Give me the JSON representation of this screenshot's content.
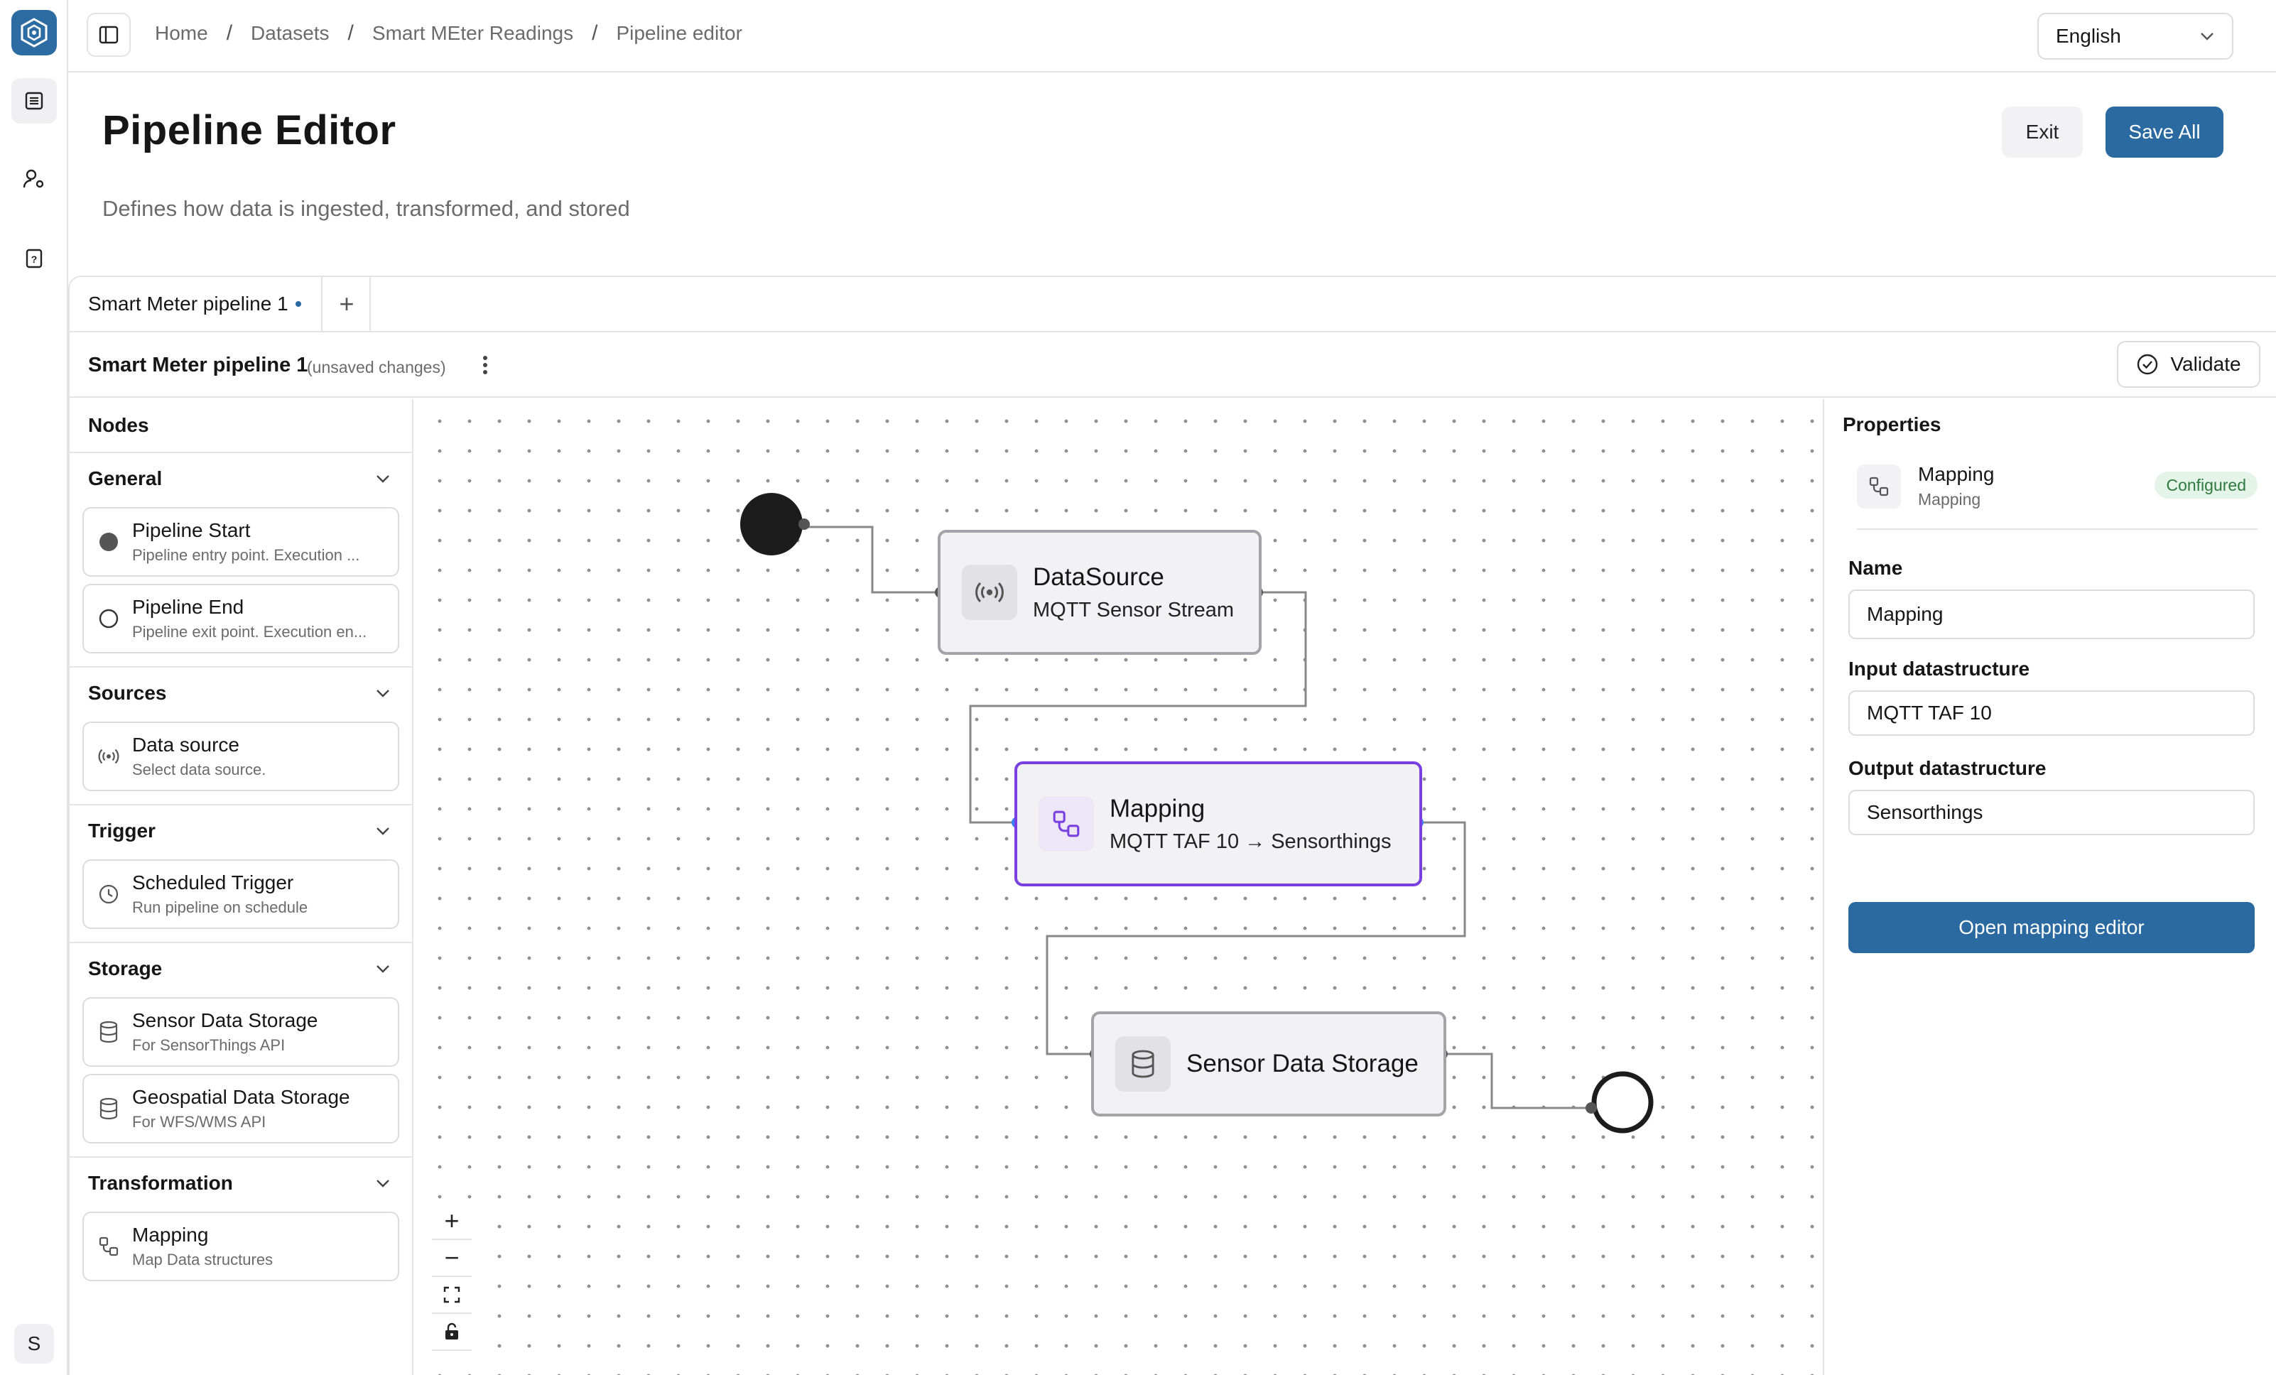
{
  "rail": {
    "items": [
      "datasets-icon",
      "user-settings-icon",
      "help-icon"
    ],
    "user_initial": "S"
  },
  "breadcrumb": [
    "Home",
    "Datasets",
    "Smart MEter Readings",
    "Pipeline editor"
  ],
  "language": "English",
  "page": {
    "title": "Pipeline Editor",
    "subtitle": "Defines how data is ingested, transformed, and stored",
    "exit_label": "Exit",
    "save_label": "Save All"
  },
  "tabs": {
    "active": "Smart Meter pipeline 1",
    "add_label": "+"
  },
  "subbar": {
    "pipeline_name": "Smart Meter pipeline 1",
    "status": "(unsaved changes)",
    "validate_label": "Validate"
  },
  "palette": {
    "heading": "Nodes",
    "groups": [
      {
        "title": "General",
        "items": [
          {
            "title": "Pipeline Start",
            "desc": "Pipeline entry point. Execution ..."
          },
          {
            "title": "Pipeline End",
            "desc": "Pipeline exit point. Execution en..."
          }
        ]
      },
      {
        "title": "Sources",
        "items": [
          {
            "title": "Data source",
            "desc": "Select data source."
          }
        ]
      },
      {
        "title": "Trigger",
        "items": [
          {
            "title": "Scheduled Trigger",
            "desc": "Run pipeline on schedule"
          }
        ]
      },
      {
        "title": "Storage",
        "items": [
          {
            "title": "Sensor Data Storage",
            "desc": "For SensorThings API"
          },
          {
            "title": "Geospatial Data Storage",
            "desc": "For WFS/WMS API"
          }
        ]
      },
      {
        "title": "Transformation",
        "items": [
          {
            "title": "Mapping",
            "desc": "Map Data structures"
          }
        ]
      }
    ]
  },
  "canvas": {
    "nodes": {
      "datasource": {
        "title": "DataSource",
        "sub": "MQTT Sensor Stream"
      },
      "mapping": {
        "title": "Mapping",
        "sub": "MQTT TAF 10 → Sensorthings"
      },
      "storage": {
        "title": "Sensor Data Storage"
      }
    },
    "zoom_controls": [
      "+",
      "−"
    ]
  },
  "properties": {
    "heading": "Properties",
    "selected": {
      "name": "Mapping",
      "type": "Mapping",
      "status": "Configured"
    },
    "fields": {
      "name_label": "Name",
      "name_value": "Mapping",
      "input_label": "Input datastructure",
      "input_value": "MQTT TAF 10",
      "output_label": "Output datastructure",
      "output_value": "Sensorthings"
    },
    "open_label": "Open mapping editor"
  },
  "colors": {
    "accent": "#2b6aa0",
    "selected_node": "#7a3fe0",
    "badge_green": "#2d7a3f"
  }
}
